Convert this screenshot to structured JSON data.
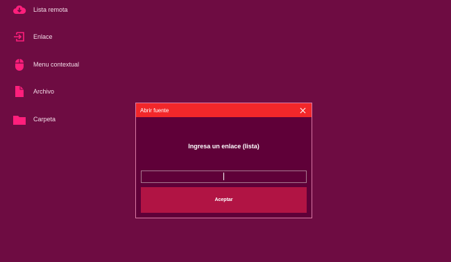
{
  "colors": {
    "background": "#6e0c42",
    "accent": "#ff1f7c",
    "dialog_title_bar": "#f2272a",
    "dialog_body": "#5f0038",
    "button": "#b11444"
  },
  "sidebar": {
    "items": [
      {
        "label": "Lista remota",
        "icon": "cloud-download-icon"
      },
      {
        "label": "Enlace",
        "icon": "link-enter-icon"
      },
      {
        "label": "Menu contextual",
        "icon": "mouse-icon"
      },
      {
        "label": "Archivo",
        "icon": "file-icon"
      },
      {
        "label": "Carpeta",
        "icon": "folder-icon"
      }
    ]
  },
  "dialog": {
    "title": "Abrir fuente",
    "prompt": "Ingresa un enlace (lista)",
    "input_value": "",
    "accept_label": "Aceptar",
    "close_icon": "close-icon"
  }
}
